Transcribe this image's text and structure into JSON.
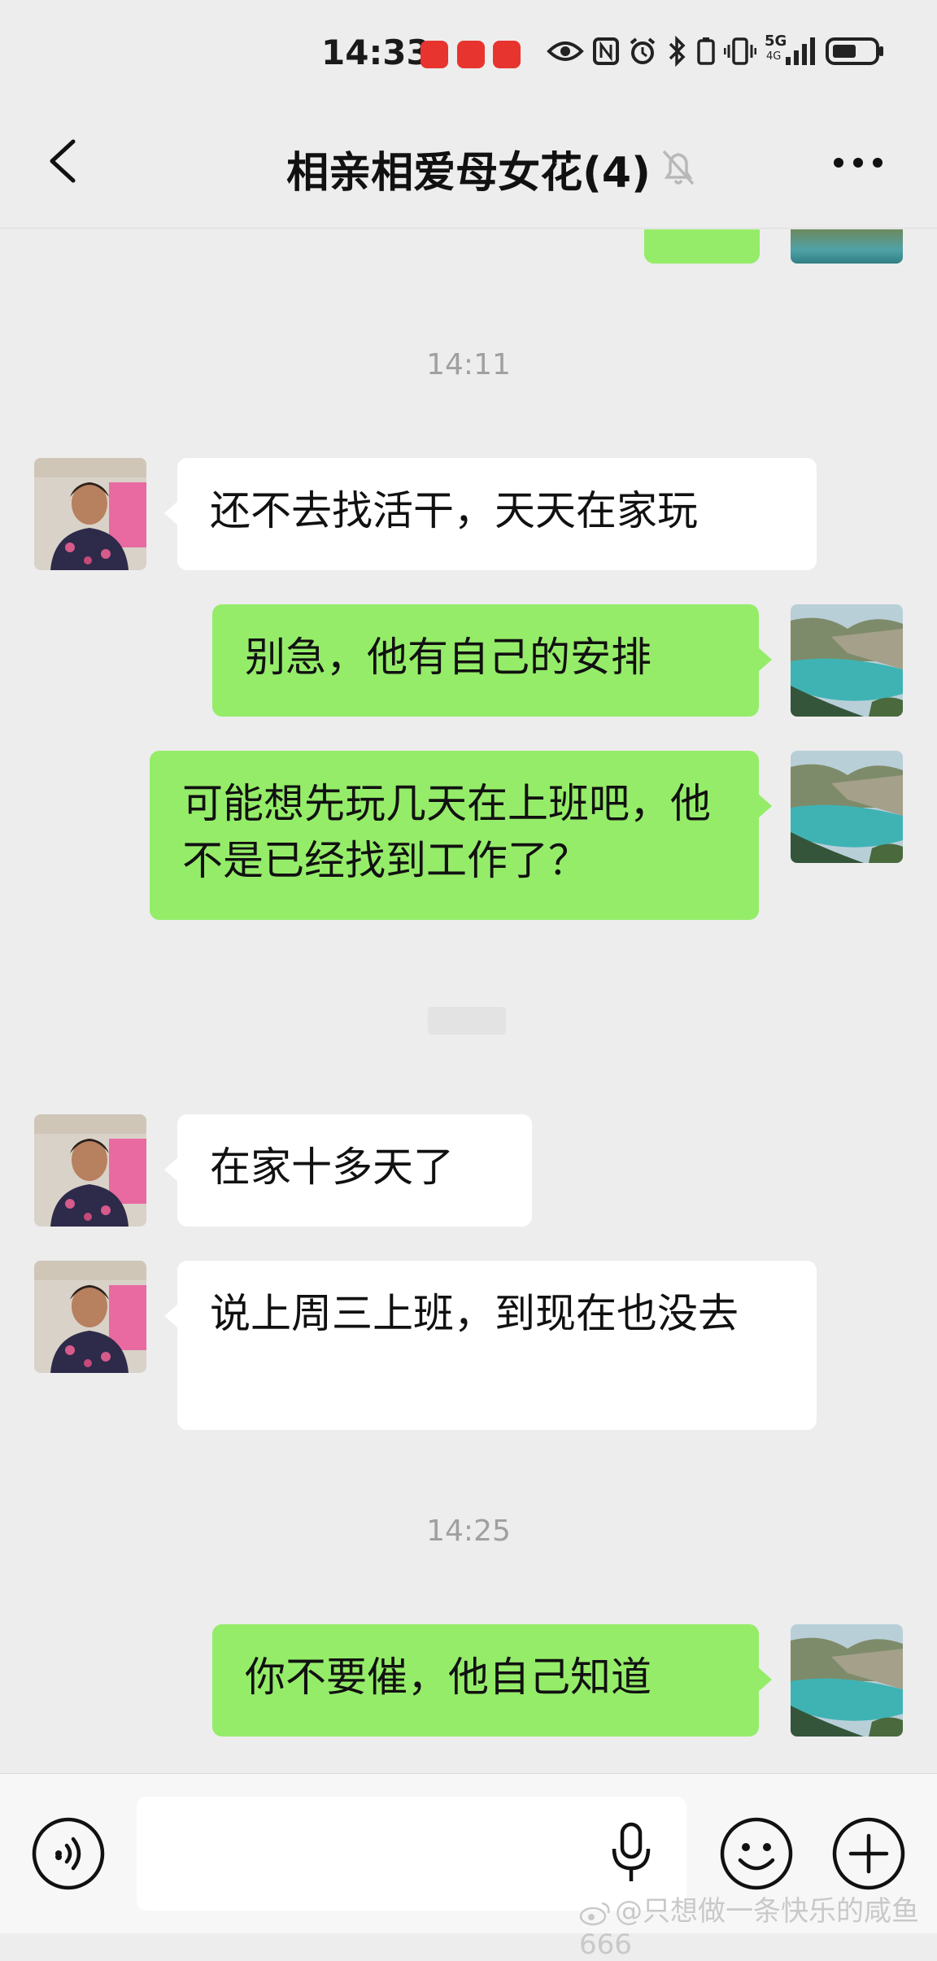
{
  "status_bar": {
    "time": "14:33",
    "network": "5G",
    "signal_small": "4G"
  },
  "header": {
    "title": "相亲相爱母女花(4)",
    "back_icon": "chevron-left-icon",
    "mute_icon": "bell-muted-icon",
    "more_icon": "more-dots-icon"
  },
  "chat": {
    "time_separators": [
      "14:11",
      "14:25"
    ],
    "messages": [
      {
        "side": "incoming",
        "text": "还不去找活干，天天在家玩"
      },
      {
        "side": "outgoing",
        "text": "别急，他有自己的安排"
      },
      {
        "side": "outgoing",
        "text": "可能想先玩几天在上班吧，他不是已经找到工作了？"
      },
      {
        "side": "incoming",
        "text": "在家十多天了"
      },
      {
        "side": "incoming",
        "text": "说上周三上班，到现在也没去"
      },
      {
        "side": "outgoing",
        "text": "你不要催，他自己知道"
      }
    ]
  },
  "input_bar": {
    "voice_icon": "voice-icon",
    "mic_icon": "mic-icon",
    "emoji_icon": "emoji-icon",
    "plus_icon": "plus-icon",
    "input_value": ""
  },
  "watermark": {
    "text": "@只想做一条快乐的咸鱼666"
  },
  "colors": {
    "background": "#ededed",
    "outgoing_bubble": "#95ec69",
    "incoming_bubble": "#ffffff",
    "timestamp": "#a0a0a0"
  }
}
